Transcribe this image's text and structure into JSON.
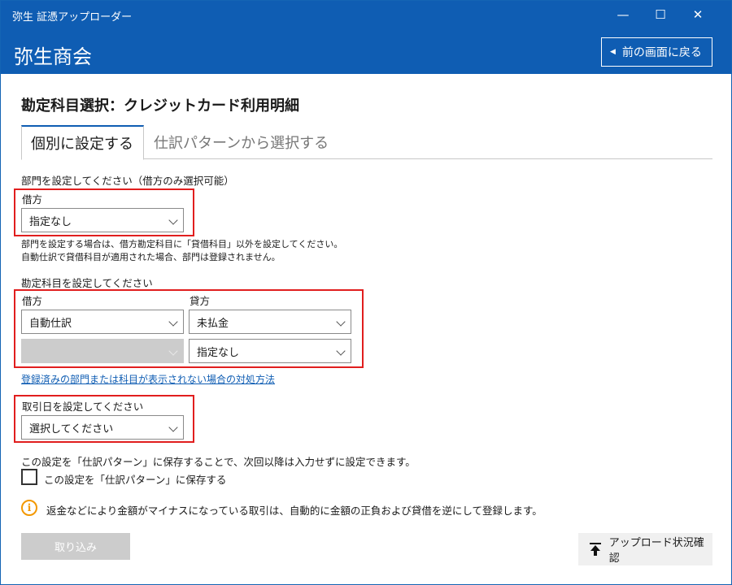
{
  "window": {
    "title": "弥生 証憑アップローダー",
    "minimize_glyph": "—",
    "maximize_glyph": "☐",
    "close_glyph": "✕"
  },
  "header": {
    "company": "弥生商会",
    "back_label": "前の画面に戻る"
  },
  "page_title": "勘定科目選択：クレジットカード利用明細",
  "tabs": [
    {
      "label": "個別に設定する",
      "active": true
    },
    {
      "label": "仕訳パターンから選択する",
      "active": false
    }
  ],
  "department": {
    "section_label": "部門を設定してください（借方のみ選択可能）",
    "debit_label": "借方",
    "debit_value": "指定なし",
    "note_line1": "部門を設定する場合は、借方勘定科目に「貸借科目」以外を設定してください。",
    "note_line2": "自動仕訳で貸借科目が適用された場合、部門は登録されません。"
  },
  "accounts": {
    "section_label": "勘定科目を設定してください",
    "debit_label": "借方",
    "credit_label": "貸方",
    "debit_value": "自動仕訳",
    "debit_sub_value": "",
    "credit_value": "未払金",
    "credit_sub_value": "指定なし"
  },
  "help_link": "登録済みの部門または科目が表示されない場合の対処方法",
  "date": {
    "section_label": "取引日を設定してください",
    "value": "選択してください"
  },
  "pattern": {
    "note": "この設定を「仕訳パターン」に保存することで、次回以降は入力せずに設定できます。",
    "checkbox_label": "この設定を「仕訳パターン」に保存する",
    "checked": false
  },
  "info": {
    "icon_glyph": "i",
    "text": "返金などにより金額がマイナスになっている取引は、自動的に金額の正負および貸借を逆にして登録します。"
  },
  "buttons": {
    "import_label": "取り込み",
    "upload_status_label": "アップロード状況確認"
  },
  "colors": {
    "brand_blue": "#0f5db3",
    "highlight_red": "#e11e1e",
    "info_orange": "#f39800",
    "disabled_gray": "#cccccc"
  }
}
